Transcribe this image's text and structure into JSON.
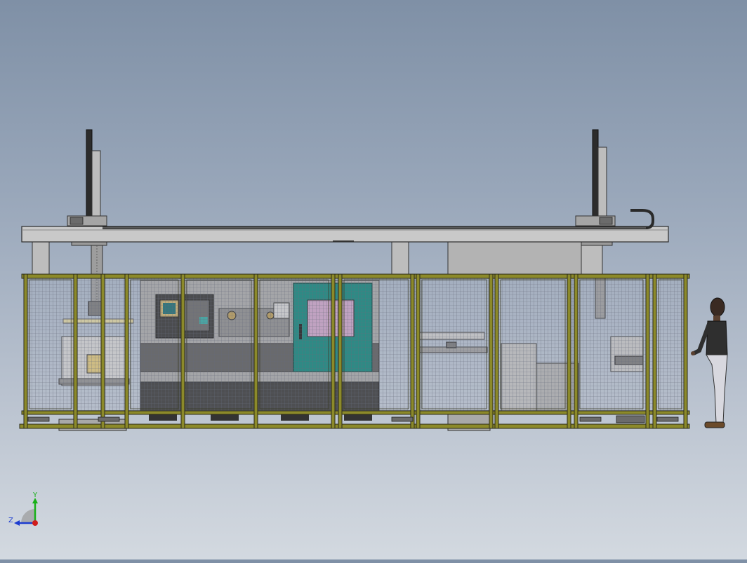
{
  "viewport": {
    "background_top": "#7f90a6",
    "background_bottom": "#d3d9e0"
  },
  "colors": {
    "frame_yellow": "#8c8a2a",
    "frame_dark": "#3a3a2a",
    "steel_light": "#c8c8c8",
    "steel_mid": "#a9a9a9",
    "steel_dark": "#5a5a5a",
    "machine_teal": "#17857c",
    "panel_pink": "#c9a3c5",
    "mesh": "#6d7280",
    "axis_x": "#d01c1c",
    "axis_y": "#18b018",
    "axis_z": "#1c3cd0"
  },
  "model": {
    "components": [
      "gantry-beam",
      "gantry-column-left",
      "gantry-column-right",
      "z-axis-left",
      "z-axis-right",
      "cable-chain",
      "safety-fence",
      "cnc-lathe",
      "control-panel",
      "conveyor",
      "human-figure"
    ]
  },
  "triad": {
    "y_label": "Y",
    "z_label": "Z",
    "origin_icon": "coordinate-triad-icon"
  }
}
